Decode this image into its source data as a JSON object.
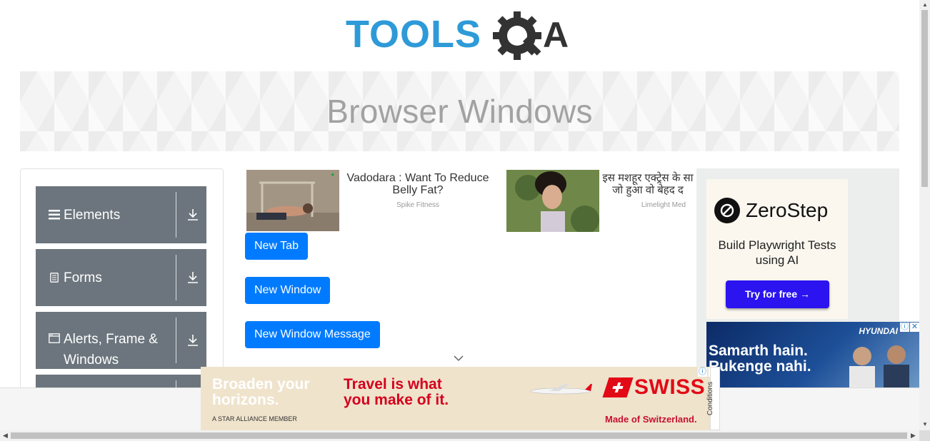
{
  "logo": {
    "text_left": "TOOLS",
    "text_right": "A",
    "colors": {
      "blue": "#2e9ad8",
      "dark": "#333333"
    }
  },
  "banner": {
    "title": "Browser Windows"
  },
  "sidebar": {
    "groups": [
      {
        "label": "Elements",
        "icon": "hamburger-icon"
      },
      {
        "label": "Forms",
        "icon": "document-icon"
      },
      {
        "label": "Alerts, Frame & Windows",
        "icon": "window-icon"
      }
    ]
  },
  "ads": {
    "native1": {
      "title": "Vadodara : Want To Reduce Belly Fat?",
      "source": "Spike Fitness"
    },
    "native2": {
      "title": "इस मशहूर एक्ट्रेस के सा जो हुआ वो बेहद द",
      "source": "Limelight Med"
    },
    "zerostep": {
      "brand": "ZeroStep",
      "tagline": "Build Playwright Tests using AI",
      "cta": "Try for free →"
    },
    "hyundai": {
      "brand": "HYUNDAI",
      "headline": "Samarth hain. Rukenge nahi."
    },
    "swiss": {
      "left_text": "Broaden your horizons.",
      "middle_text": "Travel is what you make of it.",
      "alliance": "A STAR ALLIANCE MEMBER",
      "brand": "SWISS",
      "slogan": "Made of Switzerland.",
      "conditions": "Conditions"
    }
  },
  "buttons": {
    "new_tab": "New Tab",
    "new_window": "New Window",
    "new_window_message": "New Window Message"
  },
  "colors": {
    "primary": "#007bff",
    "sidebar": "#6c757d",
    "banner_title": "#a2a2a2"
  }
}
